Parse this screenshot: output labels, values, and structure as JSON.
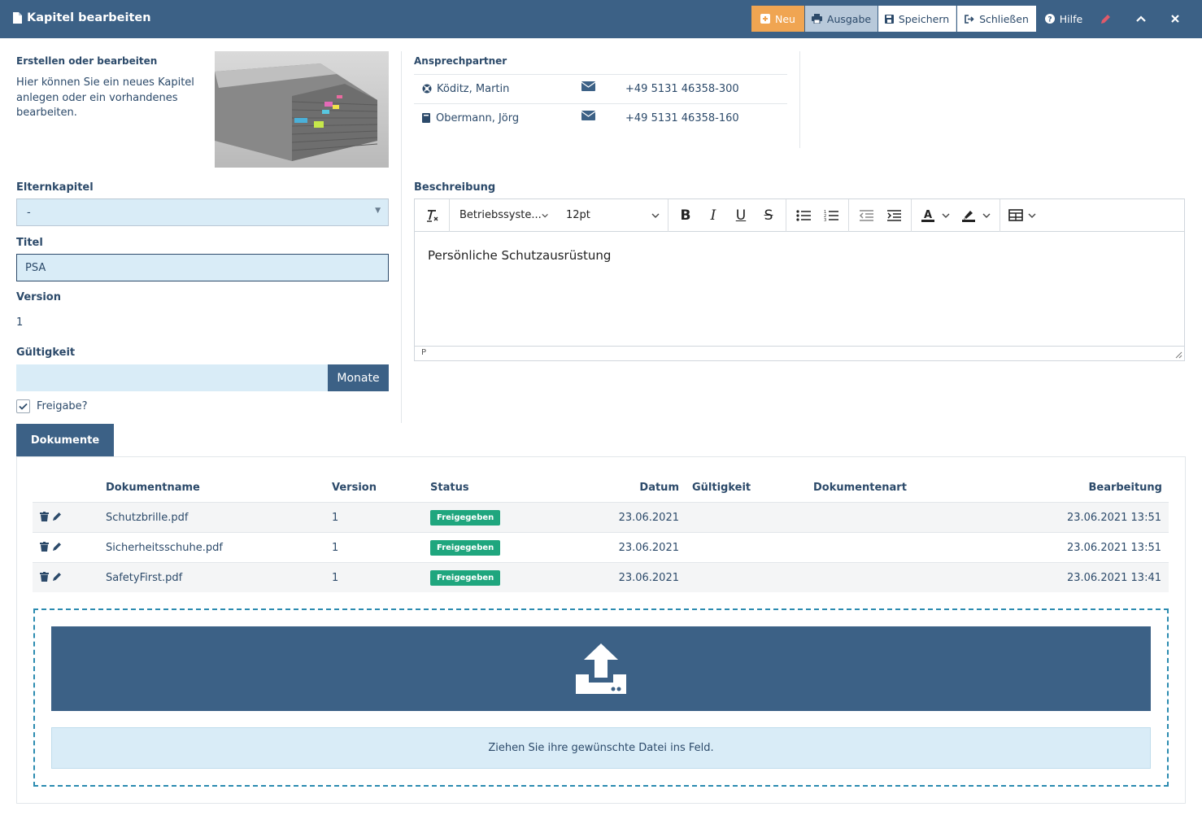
{
  "header": {
    "title": "Kapitel bearbeiten",
    "buttons": {
      "neu": "Neu",
      "ausgabe": "Ausgabe",
      "speichern": "Speichern",
      "schliessen": "Schließen",
      "hilfe": "Hilfe"
    }
  },
  "intro": {
    "title": "Erstellen oder bearbeiten",
    "text": "Hier können Sie ein neues Kapitel anlegen oder ein vorhandenes bearbeiten."
  },
  "contacts": {
    "title": "Ansprechpartner",
    "items": [
      {
        "name": "Köditz, Martin",
        "phone": "+49 5131 46358-300",
        "icon": "lifebuoy-icon"
      },
      {
        "name": "Obermann, Jörg",
        "phone": "+49 5131 46358-160",
        "icon": "book-icon"
      }
    ]
  },
  "form": {
    "parent_label": "Elternkapitel",
    "parent_value": "-",
    "title_label": "Titel",
    "title_value": "PSA",
    "version_label": "Version",
    "version_value": "1",
    "validity_label": "Gültigkeit",
    "validity_value": "",
    "validity_unit": "Monate",
    "release_label": "Freigabe?",
    "release_checked": true
  },
  "editor": {
    "label": "Beschreibung",
    "font_family": "Betriebssyste...",
    "font_size": "12pt",
    "content": "Persönliche Schutzausrüstung",
    "status_path": "P"
  },
  "tabs": {
    "documents": "Dokumente"
  },
  "table": {
    "headers": {
      "name": "Dokumentname",
      "version": "Version",
      "status": "Status",
      "date": "Datum",
      "validity": "Gültigkeit",
      "type": "Dokumentenart",
      "edited": "Bearbeitung"
    },
    "rows": [
      {
        "name": "Schutzbrille.pdf",
        "version": "1",
        "status": "Freigegeben",
        "date": "23.06.2021",
        "validity": "",
        "type": "",
        "edited": "23.06.2021 13:51"
      },
      {
        "name": "Sicherheitsschuhe.pdf",
        "version": "1",
        "status": "Freigegeben",
        "date": "23.06.2021",
        "validity": "",
        "type": "",
        "edited": "23.06.2021 13:51"
      },
      {
        "name": "SafetyFirst.pdf",
        "version": "1",
        "status": "Freigegeben",
        "date": "23.06.2021",
        "validity": "",
        "type": "",
        "edited": "23.06.2021 13:41"
      }
    ]
  },
  "upload": {
    "hint": "Ziehen Sie ihre gewünschte Datei ins Feld."
  },
  "colors": {
    "primary": "#3c6186",
    "accent": "#f0a552",
    "input_bg": "#d9ecf7",
    "badge_green": "#1fa67e"
  }
}
